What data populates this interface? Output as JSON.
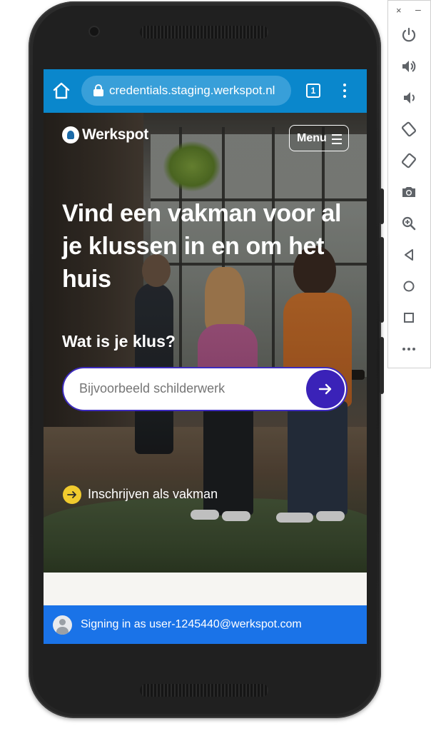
{
  "emulator_panel": {
    "close_label": "×",
    "minimize_label": "–",
    "buttons": [
      {
        "name": "power-icon"
      },
      {
        "name": "volume-up-icon"
      },
      {
        "name": "volume-down-icon"
      },
      {
        "name": "rotate-left-icon"
      },
      {
        "name": "rotate-right-icon"
      },
      {
        "name": "camera-icon"
      },
      {
        "name": "zoom-icon"
      },
      {
        "name": "back-icon"
      },
      {
        "name": "home-icon"
      },
      {
        "name": "overview-icon"
      },
      {
        "name": "more-icon"
      }
    ]
  },
  "browser": {
    "url": "credentials.staging.werkspot.nl",
    "tab_count": "1",
    "toolbar_color": "#0a87cc"
  },
  "site": {
    "logo_text": "Werkspot",
    "menu_label": "Menu",
    "headline": "Vind een vakman voor al je klussen in en om het huis",
    "subhead": "Wat is je klus?",
    "search": {
      "placeholder": "Bijvoorbeeld schilderwerk",
      "button_color": "#3a22b8"
    },
    "signup_label": "Inschrijven als vakman",
    "signup_icon_color": "#f1cb2e"
  },
  "signing_bar": {
    "text": "Signing in as user-1245440@werkspot.com",
    "color": "#1a73e8"
  }
}
